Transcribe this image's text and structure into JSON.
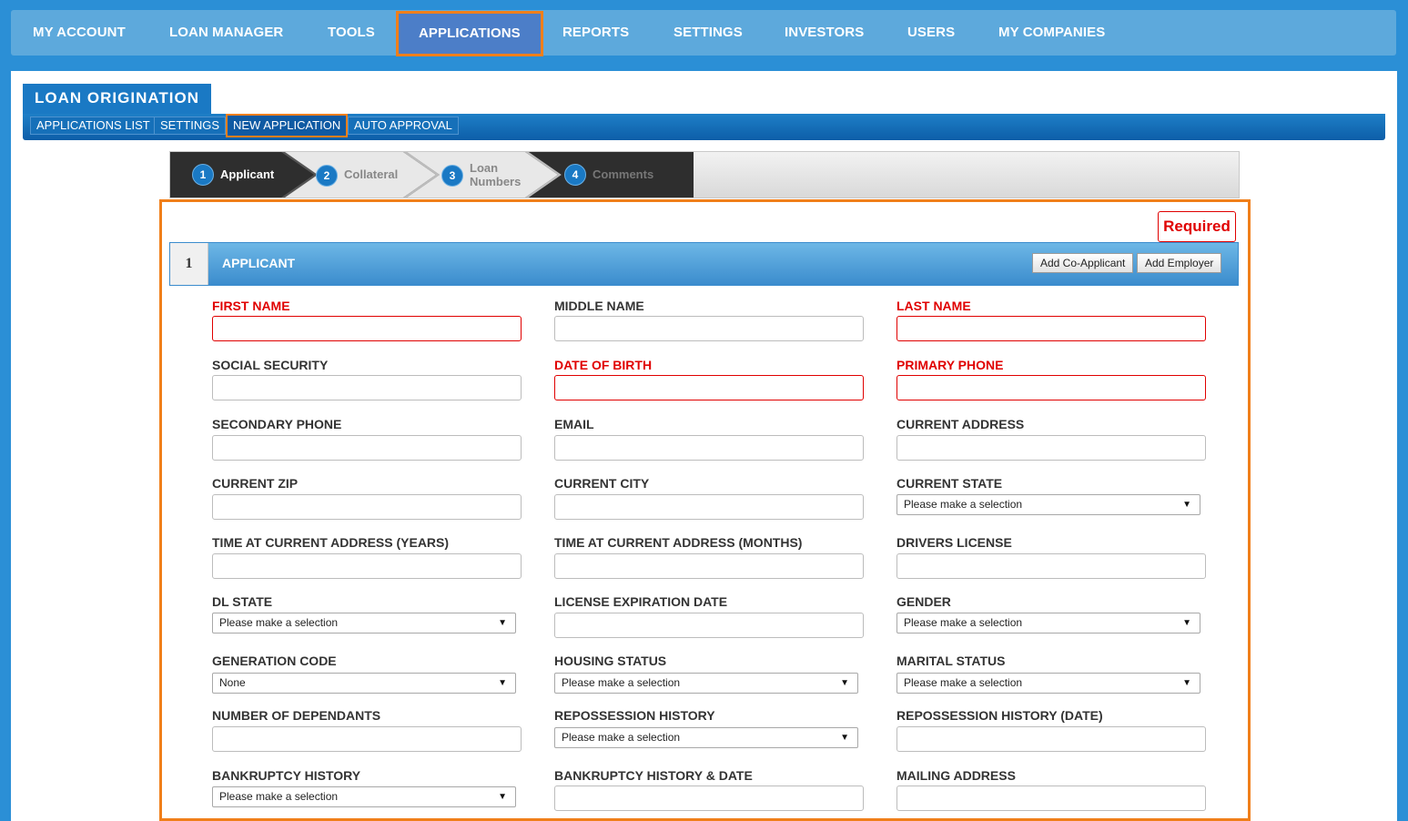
{
  "topnav": {
    "items": [
      "MY ACCOUNT",
      "LOAN MANAGER",
      "TOOLS",
      "APPLICATIONS",
      "REPORTS",
      "SETTINGS",
      "INVESTORS",
      "USERS",
      "MY COMPANIES"
    ]
  },
  "section": {
    "title": "LOAN ORIGINATION",
    "subnav": [
      "APPLICATIONS LIST",
      "SETTINGS",
      "NEW APPLICATION",
      "AUTO APPROVAL"
    ]
  },
  "wizard": {
    "steps": [
      {
        "num": "1",
        "label": "Applicant"
      },
      {
        "num": "2",
        "label": "Collateral"
      },
      {
        "num": "3",
        "label_line1": "Loan",
        "label_line2": "Numbers"
      },
      {
        "num": "4",
        "label": "Comments"
      }
    ]
  },
  "form": {
    "required_badge": "Required",
    "section_number": "1",
    "section_title": "APPLICANT",
    "add_co_applicant": "Add Co-Applicant",
    "add_employer": "Add Employer",
    "fields": {
      "first_name": "FIRST NAME",
      "middle_name": "MIDDLE NAME",
      "last_name": "LAST NAME",
      "social_security": "SOCIAL SECURITY",
      "date_of_birth": "DATE OF BIRTH",
      "primary_phone": "PRIMARY PHONE",
      "secondary_phone": "SECONDARY PHONE",
      "email": "EMAIL",
      "current_address": "CURRENT ADDRESS",
      "current_zip": "CURRENT ZIP",
      "current_city": "CURRENT CITY",
      "current_state": "CURRENT STATE",
      "time_years": "TIME AT CURRENT ADDRESS (YEARS)",
      "time_months": "TIME AT CURRENT ADDRESS (MONTHS)",
      "drivers_license": "DRIVERS LICENSE",
      "dl_state": "DL STATE",
      "license_expiration": "LICENSE EXPIRATION DATE",
      "gender": "GENDER",
      "generation_code": "GENERATION CODE",
      "housing_status": "HOUSING STATUS",
      "marital_status": "MARITAL STATUS",
      "dependants": "NUMBER OF DEPENDANTS",
      "repossession_history": "REPOSSESSION HISTORY",
      "repossession_history_date": "REPOSSESSION HISTORY (DATE)",
      "bankruptcy_history": "BANKRUPTCY HISTORY",
      "bankruptcy_history_date": "BANKRUPTCY HISTORY & DATE",
      "mailing_address": "MAILING ADDRESS"
    },
    "select_values": {
      "placeholder": "Please make a selection",
      "generation_code": "None"
    }
  },
  "colors": {
    "page_bg": "#2b8fd6",
    "nav_bg": "#5da9dc",
    "highlight": "#f07f1a",
    "required": "#e00000",
    "section_blue": "#1a79c4"
  }
}
